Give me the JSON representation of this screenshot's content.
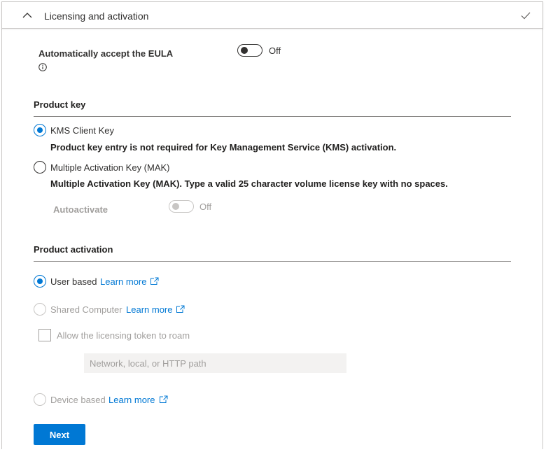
{
  "header": {
    "title": "Licensing and activation",
    "collapse_icon": "chevron-up-icon",
    "status_icon": "check-icon"
  },
  "eula": {
    "label": "Automatically accept the EULA",
    "toggle_state": "Off",
    "info_icon": "info-icon"
  },
  "product_key": {
    "section_title": "Product key",
    "kms": {
      "label": "KMS Client Key",
      "description": "Product key entry is not required for Key Management Service (KMS) activation.",
      "selected": true
    },
    "mak": {
      "label": "Multiple Activation Key (MAK)",
      "description": "Multiple Activation Key (MAK). Type a valid 25 character volume license key with no spaces.",
      "selected": false
    },
    "autoactivate": {
      "label": "Autoactivate",
      "toggle_state": "Off",
      "disabled": true
    }
  },
  "product_activation": {
    "section_title": "Product activation",
    "user_based": {
      "label": "User based",
      "link": "Learn more",
      "selected": true
    },
    "shared_computer": {
      "label": "Shared Computer",
      "link": "Learn more",
      "selected": false,
      "disabled": true
    },
    "roam": {
      "label": "Allow the licensing token to roam",
      "checked": false,
      "disabled": true
    },
    "path_input": {
      "placeholder": "Network, local, or HTTP path",
      "value": ""
    },
    "device_based": {
      "label": "Device based",
      "link": "Learn more",
      "selected": false,
      "disabled": true
    }
  },
  "actions": {
    "next_label": "Next"
  },
  "colors": {
    "accent": "#0078d4",
    "text": "#201f1e",
    "disabled": "#a19f9d"
  }
}
